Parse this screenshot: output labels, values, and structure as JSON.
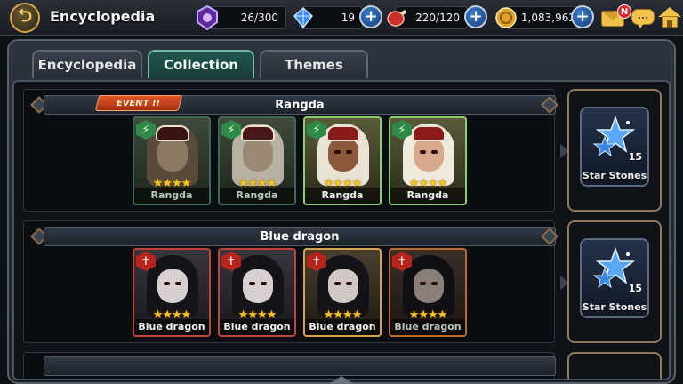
{
  "header": {
    "title": "Encyclopedia",
    "resources": [
      {
        "name": "level-emblem",
        "value": "26/300",
        "icon": "purple-emblem-icon"
      },
      {
        "name": "crystals",
        "value": "19",
        "icon": "blue-crystal-icon"
      },
      {
        "name": "stamina",
        "value": "220/120",
        "icon": "meat-icon"
      },
      {
        "name": "gold",
        "value": "1,083,962",
        "icon": "gold-coin-icon"
      }
    ],
    "plus_label": "+",
    "mail_badge": "N",
    "chat_glyph": "...",
    "back_glyph": "⮌"
  },
  "tabs": [
    {
      "label": "Encyclopedia",
      "active": false
    },
    {
      "label": "Collection",
      "active": true
    },
    {
      "label": "Themes",
      "active": false
    }
  ],
  "sections": [
    {
      "title": "Rangda",
      "event_label": "EVENT !!",
      "cards": [
        {
          "name": "Rangda",
          "stars": "★★★★",
          "role_glyph": "⚡"
        },
        {
          "name": "Rangda",
          "stars": "★★★★",
          "role_glyph": "⚡"
        },
        {
          "name": "Rangda",
          "stars": "★★★★",
          "role_glyph": "⚡"
        },
        {
          "name": "Rangda",
          "stars": "★★★★",
          "role_glyph": "⚡"
        }
      ],
      "reward": {
        "label": "Star Stones",
        "count": "15"
      }
    },
    {
      "title": "Blue dragon",
      "cards": [
        {
          "name": "Blue dragon",
          "stars": "★★★★",
          "role_glyph": "✝"
        },
        {
          "name": "Blue dragon",
          "stars": "★★★★",
          "role_glyph": "✝"
        },
        {
          "name": "Blue dragon",
          "stars": "★★★★",
          "role_glyph": "✝"
        },
        {
          "name": "Blue dragon",
          "stars": "★★★★",
          "role_glyph": "✝"
        }
      ],
      "reward": {
        "label": "Star Stones",
        "count": "15"
      }
    }
  ],
  "colors": {
    "accent_tab": "#20574f",
    "gold": "#f0c14b",
    "star": "#f5c628",
    "event": "#e2562a"
  }
}
